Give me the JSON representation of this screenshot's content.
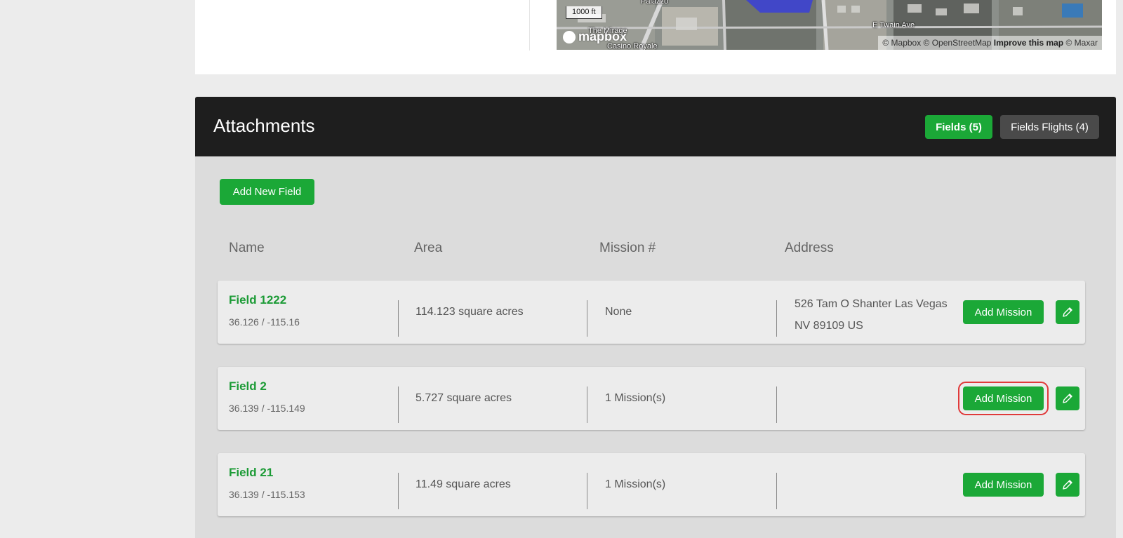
{
  "map": {
    "scale_label": "1000 ft",
    "logo_text": "mapbox",
    "labels": [
      "Palazzo",
      "The Mirage",
      "Casino Royale",
      "E Twain Ave"
    ],
    "attribution_prefix": "© Mapbox © OpenStreetMap",
    "attribution_link": "Improve this map",
    "attribution_suffix": "© Maxar"
  },
  "attachments": {
    "title": "Attachments",
    "tabs": {
      "fields": "Fields (5)",
      "flights": "Fields Flights (4)"
    },
    "add_field_label": "Add New Field",
    "columns": {
      "name": "Name",
      "area": "Area",
      "missions": "Mission #",
      "address": "Address"
    },
    "add_mission_label": "Add Mission",
    "rows": [
      {
        "name": "Field 1222",
        "coords": "36.126 / -115.16",
        "area": "114.123 square acres",
        "missions": "None",
        "address_line1": "526 Tam O Shanter Las Vegas",
        "address_line2": "NV 89109 US"
      },
      {
        "name": "Field 2",
        "coords": "36.139 / -115.149",
        "area": "5.727 square acres",
        "missions": "1 Mission(s)",
        "address_line1": "",
        "address_line2": ""
      },
      {
        "name": "Field 21",
        "coords": "36.139 / -115.153",
        "area": "11.49 square acres",
        "missions": "1 Mission(s)",
        "address_line1": "",
        "address_line2": ""
      }
    ]
  },
  "colors": {
    "accent_green": "#1ba837",
    "field_name_green": "#1c9b36",
    "header_dark": "#1e1e1e",
    "highlight_red": "#e03a3a"
  }
}
